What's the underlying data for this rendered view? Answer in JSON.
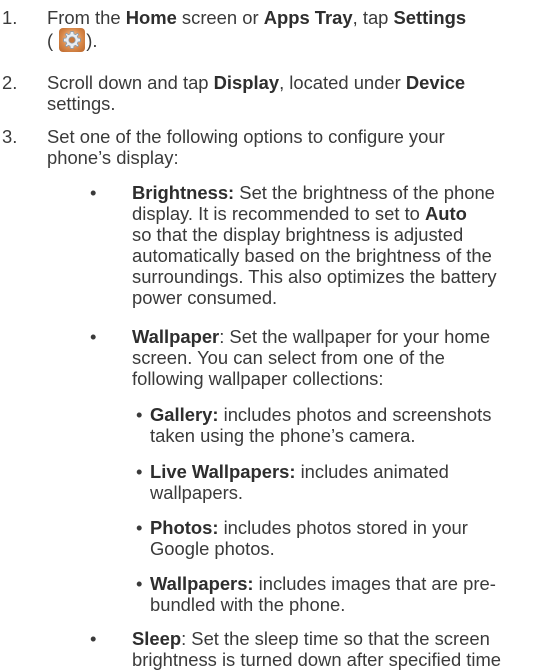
{
  "steps": [
    {
      "num": "1.",
      "pre": "From the ",
      "b1": "Home",
      "mid1": " screen or ",
      "b2": "Apps Tray",
      "mid2": ", tap ",
      "b3": "Settings",
      "paren_open": " (",
      "icon": "settings-gear-icon",
      "paren_close": ")."
    },
    {
      "num": "2.",
      "pre": "Scroll down and tap ",
      "b1": "Display",
      "mid1": ", located under ",
      "b2": "Device",
      "line2": "settings."
    },
    {
      "num": "3.",
      "line1": "Set one of the following options to configure your",
      "line2": "phone’s display:"
    }
  ],
  "options": [
    {
      "title": "Brightness:",
      "line1": " Set the brightness of the phone",
      "line2": "display. It is recommended to set to ",
      "bold2": "Auto",
      "line3": "so that the display brightness is adjusted",
      "line4": "automatically based on the brightness of the",
      "line5": "surroundings. This also optimizes the battery",
      "line6": "power consumed."
    },
    {
      "title": "Wallpaper",
      "line1": ": Set the wallpaper for your home",
      "line2": "screen. You can select from one of the",
      "line3": "following wallpaper collections:"
    },
    {
      "title": "Sleep",
      "line1": ": Set the sleep time so that the screen",
      "line2": "brightness is turned down after specified time"
    }
  ],
  "collections": [
    {
      "title": "Gallery:",
      "line1": " includes photos and screenshots",
      "line2": "taken using the phone’s camera."
    },
    {
      "title": "Live Wallpapers:",
      "line1": " includes animated",
      "line2": "wallpapers."
    },
    {
      "title": "Photos:",
      "line1": " includes photos stored in your",
      "line2": "Google photos."
    },
    {
      "title": "Wallpapers:",
      "line1": " includes images that are pre-",
      "line2": "bundled with the phone."
    }
  ],
  "bullet": "•"
}
